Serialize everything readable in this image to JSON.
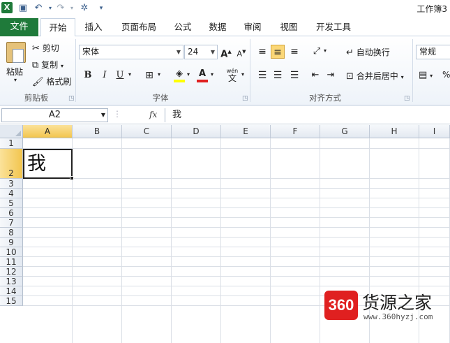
{
  "title_bar": {
    "excel_logo": "X",
    "app_title": "工作簿3",
    "quick_access": [
      "save-icon",
      "undo-icon",
      "redo-icon",
      "tools-icon",
      "customize-icon"
    ]
  },
  "ribbon_tabs": {
    "file": "文件",
    "tabs": [
      "开始",
      "插入",
      "页面布局",
      "公式",
      "数据",
      "审阅",
      "视图",
      "开发工具"
    ],
    "active": "开始"
  },
  "clipboard": {
    "label": "剪贴板",
    "paste": "粘贴",
    "cut": "剪切",
    "copy": "复制",
    "format_painter": "格式刷"
  },
  "font": {
    "label": "字体",
    "font_name": "宋体",
    "font_size": "24",
    "bold": "B",
    "italic": "I",
    "underline": "U",
    "grow": "A",
    "shrink": "A",
    "font_color_letter": "A",
    "wen": "wén",
    "wen_char": "文"
  },
  "alignment": {
    "label": "对齐方式",
    "wrap_text": "自动换行",
    "merge_center": "合并后居中"
  },
  "number": {
    "format": "常规",
    "percent": "%"
  },
  "formula_bar": {
    "name_box": "A2",
    "fx": "fx",
    "content": "我"
  },
  "sheet": {
    "columns": [
      "A",
      "B",
      "C",
      "D",
      "E",
      "F",
      "G",
      "H",
      "I"
    ],
    "rows": [
      "1",
      "2",
      "3",
      "4",
      "5",
      "6",
      "7",
      "8",
      "9",
      "10",
      "11",
      "12",
      "13",
      "14",
      "15"
    ],
    "active_cell": "A2",
    "cell_a2": "我"
  },
  "watermark": {
    "badge": "360",
    "title": "货源之家",
    "url": "www.360hyzj.com"
  },
  "colors": {
    "file_tab": "#1f7a3a",
    "active_header": "#f2c54e",
    "watermark_badge": "#e02020"
  }
}
